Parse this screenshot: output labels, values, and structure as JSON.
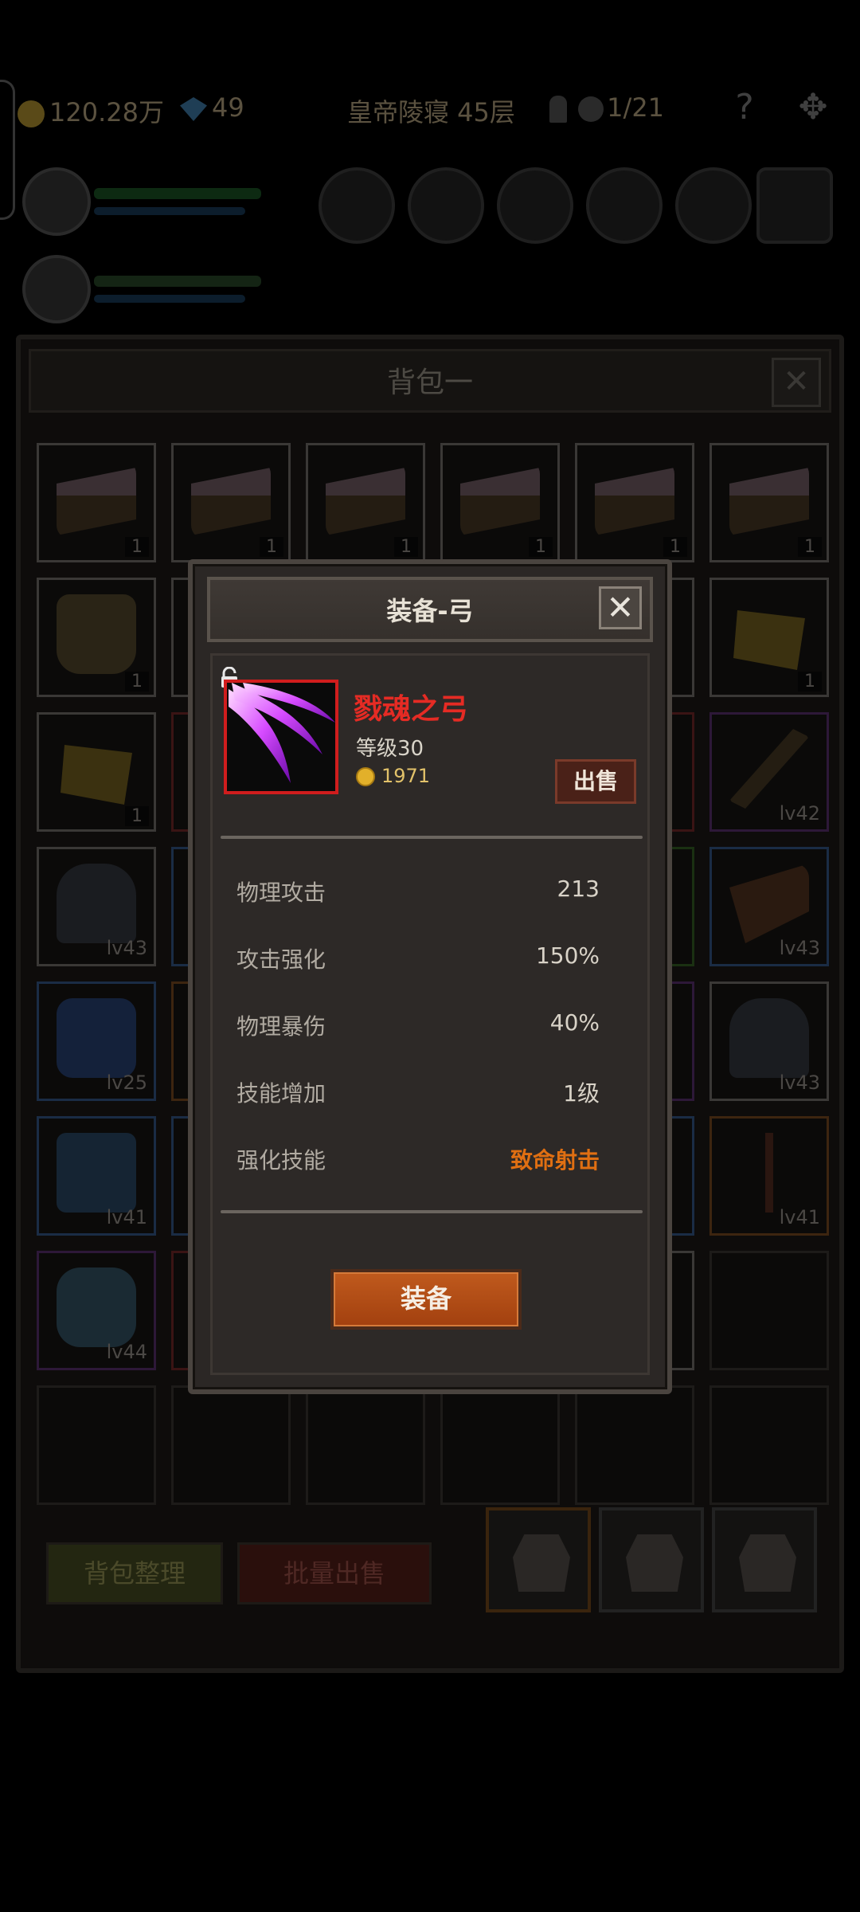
{
  "topbar": {
    "gold": "120.28万",
    "gems": "49",
    "location": "皇帝陵寝 45层",
    "keys": "1/21",
    "help_icon": "question-icon",
    "settings_icon": "gear-icon"
  },
  "bag": {
    "title": "背包一",
    "close_label": "✕",
    "sort_label": "背包整理",
    "bulk_sell_label": "批量出售",
    "slots": [
      {
        "art": "cake",
        "qty": "1",
        "rarity": "gray"
      },
      {
        "art": "cake",
        "qty": "1",
        "rarity": "gray"
      },
      {
        "art": "cake",
        "qty": "1",
        "rarity": "gray"
      },
      {
        "art": "cake",
        "qty": "1",
        "rarity": "gray"
      },
      {
        "art": "cake",
        "qty": "1",
        "rarity": "gray"
      },
      {
        "art": "cake",
        "qty": "1",
        "rarity": "gray"
      },
      {
        "art": "beer",
        "qty": "1",
        "rarity": "gray"
      },
      {
        "art": "",
        "qty": "",
        "rarity": "gray"
      },
      {
        "art": "",
        "qty": "",
        "rarity": "gray"
      },
      {
        "art": "",
        "qty": "",
        "rarity": "gray"
      },
      {
        "art": "",
        "qty": "",
        "rarity": "gray"
      },
      {
        "art": "cheese",
        "qty": "1",
        "rarity": "gray"
      },
      {
        "art": "cheese",
        "qty": "1",
        "rarity": "gray"
      },
      {
        "art": "",
        "qty": "",
        "rarity": "red"
      },
      {
        "art": "",
        "qty": "",
        "rarity": "gray"
      },
      {
        "art": "",
        "qty": "",
        "rarity": "gray"
      },
      {
        "art": "",
        "qty": "",
        "rarity": "red"
      },
      {
        "art": "weapon",
        "lvl": "lv42",
        "rarity": "purple"
      },
      {
        "art": "armor",
        "lvl": "lv43",
        "rarity": "gray"
      },
      {
        "art": "",
        "qty": "",
        "rarity": "blue"
      },
      {
        "art": "",
        "qty": "",
        "rarity": "gray"
      },
      {
        "art": "",
        "qty": "",
        "rarity": "gray"
      },
      {
        "art": "",
        "qty": "",
        "rarity": "green"
      },
      {
        "art": "gauntlet",
        "lvl": "lv43",
        "rarity": "blue"
      },
      {
        "art": "boots",
        "lvl": "lv25",
        "rarity": "blue"
      },
      {
        "art": "",
        "qty": "",
        "rarity": "orange"
      },
      {
        "art": "",
        "qty": "",
        "rarity": "gray"
      },
      {
        "art": "",
        "qty": "",
        "rarity": "gray"
      },
      {
        "art": "",
        "qty": "",
        "rarity": "purple"
      },
      {
        "art": "armor",
        "lvl": "lv43",
        "rarity": "gray"
      },
      {
        "art": "leg",
        "lvl": "lv41",
        "rarity": "blue"
      },
      {
        "art": "",
        "qty": "",
        "rarity": "blue"
      },
      {
        "art": "",
        "qty": "",
        "rarity": "gray"
      },
      {
        "art": "",
        "qty": "",
        "rarity": "gray"
      },
      {
        "art": "",
        "qty": "",
        "rarity": "blue"
      },
      {
        "art": "trident",
        "lvl": "lv41",
        "rarity": "orange"
      },
      {
        "art": "glove",
        "lvl": "lv44",
        "rarity": "purple"
      },
      {
        "art": "",
        "qty": "",
        "rarity": "red"
      },
      {
        "art": "",
        "qty": "",
        "rarity": "gray"
      },
      {
        "art": "",
        "qty": "",
        "rarity": "gray"
      },
      {
        "art": "",
        "qty": "",
        "rarity": "gray"
      },
      {
        "art": "",
        "qty": "",
        "rarity": "empty"
      },
      {
        "art": "",
        "qty": "",
        "rarity": "empty"
      },
      {
        "art": "",
        "qty": "",
        "rarity": "empty"
      },
      {
        "art": "",
        "qty": "",
        "rarity": "empty"
      },
      {
        "art": "",
        "qty": "",
        "rarity": "empty"
      },
      {
        "art": "",
        "qty": "",
        "rarity": "empty"
      },
      {
        "art": "",
        "qty": "",
        "rarity": "empty"
      }
    ]
  },
  "modal": {
    "title": "装备-弓",
    "close_label": "✕",
    "item": {
      "name": "戮魂之弓",
      "level": "等级30",
      "price": "1971",
      "sell_label": "出售",
      "icon": "bow-claw-icon",
      "rarity_color": "#d01d1d"
    },
    "stats": [
      {
        "label": "物理攻击",
        "value": "213"
      },
      {
        "label": "攻击强化",
        "value": "150%"
      },
      {
        "label": "物理暴伤",
        "value": "40%"
      },
      {
        "label": "技能增加",
        "value": "1级"
      },
      {
        "label": "强化技能",
        "value": "致命射击",
        "highlight": true
      }
    ],
    "equip_label": "装备"
  },
  "colors": {
    "accent_orange": "#e06f12",
    "item_name_red": "#e52b24",
    "equip_button": "#b24c15"
  }
}
